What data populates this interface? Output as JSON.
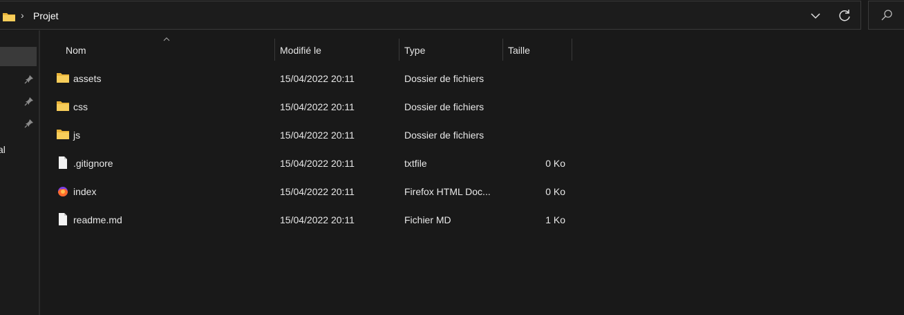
{
  "address_bar": {
    "breadcrumb": "Projet"
  },
  "columns": {
    "name": "Nom",
    "modified": "Modifié le",
    "type": "Type",
    "size": "Taille"
  },
  "nav": {
    "partial_label": "al"
  },
  "files": [
    {
      "name": "assets",
      "modified": "15/04/2022 20:11",
      "type": "Dossier de fichiers",
      "size": "",
      "icon": "folder-icon"
    },
    {
      "name": "css",
      "modified": "15/04/2022 20:11",
      "type": "Dossier de fichiers",
      "size": "",
      "icon": "folder-icon"
    },
    {
      "name": "js",
      "modified": "15/04/2022 20:11",
      "type": "Dossier de fichiers",
      "size": "",
      "icon": "folder-icon"
    },
    {
      "name": ".gitignore",
      "modified": "15/04/2022 20:11",
      "type": "txtfile",
      "size": "0 Ko",
      "icon": "file-icon"
    },
    {
      "name": "index",
      "modified": "15/04/2022 20:11",
      "type": "Firefox HTML Doc...",
      "size": "0 Ko",
      "icon": "firefox-icon"
    },
    {
      "name": "readme.md",
      "modified": "15/04/2022 20:11",
      "type": "Fichier MD",
      "size": "1 Ko",
      "icon": "file-icon"
    }
  ],
  "colors": {
    "background": "#191919",
    "folder": "#f0c04a",
    "border": "#3a3a3a"
  }
}
